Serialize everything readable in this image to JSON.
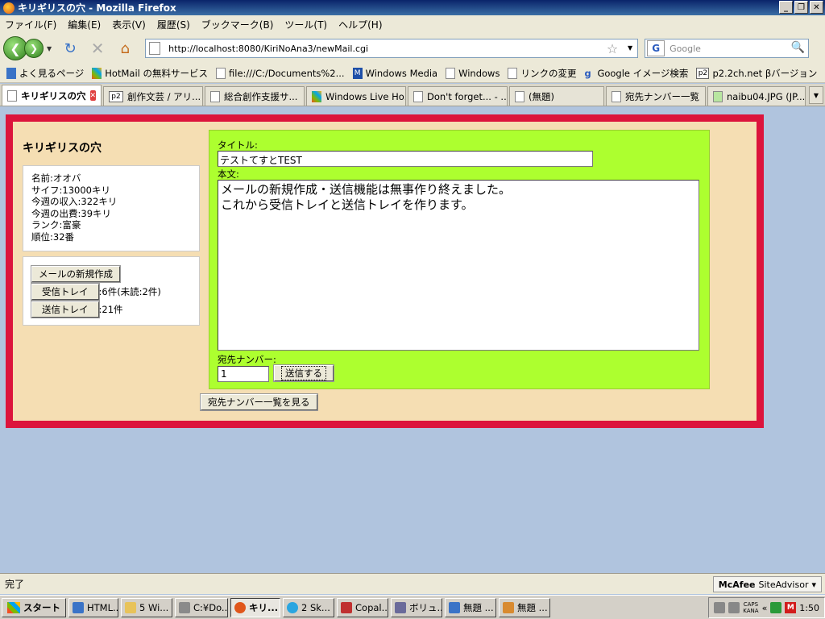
{
  "window": {
    "title": "キリギリスの穴 - Mozilla Firefox"
  },
  "menu": [
    "ファイル(F)",
    "編集(E)",
    "表示(V)",
    "履歴(S)",
    "ブックマーク(B)",
    "ツール(T)",
    "ヘルプ(H)"
  ],
  "nav": {
    "url": "http://localhost:8080/KiriNoAna3/newMail.cgi",
    "search_placeholder": "Google"
  },
  "bookmarks": [
    "よく見るページ",
    "HotMail の無料サービス",
    "file:///C:/Documents%2...",
    "Windows Media",
    "Windows",
    "リンクの変更",
    "Google イメージ検索",
    "p2.2ch.net βバージョン"
  ],
  "tabs": [
    "キリギリスの穴",
    "創作文芸 / アリ...",
    "総合創作支援サ...",
    "Windows Live Ho...",
    "Don't forget... - ...",
    "(無題)",
    "宛先ナンバー一覧",
    "naibu04.JPG (JP..."
  ],
  "page": {
    "site_title": "キリギリスの穴",
    "profile": {
      "name": "名前:オオバ",
      "size": "サイフ:13000キリ",
      "income": "今週の収入:322キリ",
      "expense": "今週の出費:39キリ",
      "rank": "ランク:富豪",
      "position": "順位:32番"
    },
    "mail_menu": {
      "new_mail": "メールの新規作成",
      "inbox": "受信トレイ",
      "inbox_count": ":6件(未読:2件)",
      "sent": "送信トレイ",
      "sent_count": ":21件"
    },
    "compose": {
      "title_label": "タイトル:",
      "title_value": "テストてすとTEST",
      "body_label": "本文:",
      "body_line1": "メールの新規作成・送信機能は無事作り終えました。",
      "body_line2": "これから受信トレイと送信トレイを作ります。",
      "dest_label": "宛先ナンバー:",
      "dest_value": "1",
      "send_button": "送信する"
    },
    "list_button": "宛先ナンバー一覧を見る"
  },
  "status": {
    "text": "完了",
    "mcafee_brand": "McAfee",
    "mcafee_product": "SiteAdvisor"
  },
  "taskbar": {
    "start": "スタート",
    "items": [
      "HTML...",
      "5 Wi...",
      "C:¥Do...",
      "キリ...",
      "2 Sk...",
      "Copal...",
      "ボリュ...",
      "無題 ...",
      "無題 ..."
    ],
    "clock": "1:50",
    "caps": "CAPS",
    "kana": "KANA"
  },
  "colors": {
    "frame_border": "#dc143c",
    "frame_bg": "#f5deb3",
    "compose_bg": "#adff2f",
    "page_bg": "#b0c4de"
  }
}
